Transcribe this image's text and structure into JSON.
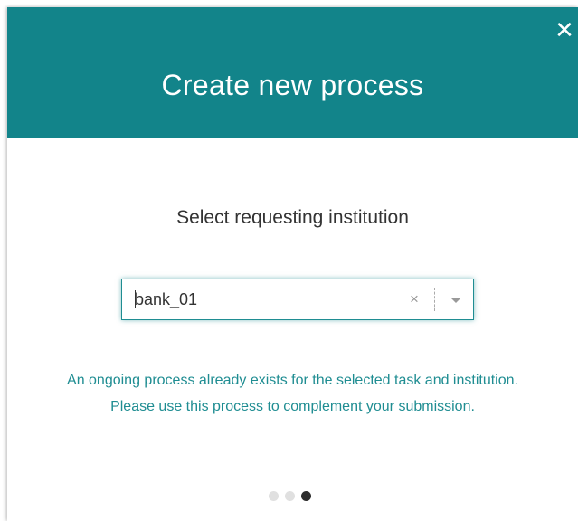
{
  "dialog": {
    "title": "Create new process",
    "close_label": "✕"
  },
  "form": {
    "prompt": "Select requesting institution",
    "select": {
      "value": "bank_01",
      "clear_label": "×"
    }
  },
  "message": "An ongoing process already exists for the selected task and institution. Please use this process to complement your submission.",
  "steps": {
    "total": 3,
    "current": 3
  },
  "colors": {
    "header": "#12848a",
    "accent": "#1f8d92"
  }
}
